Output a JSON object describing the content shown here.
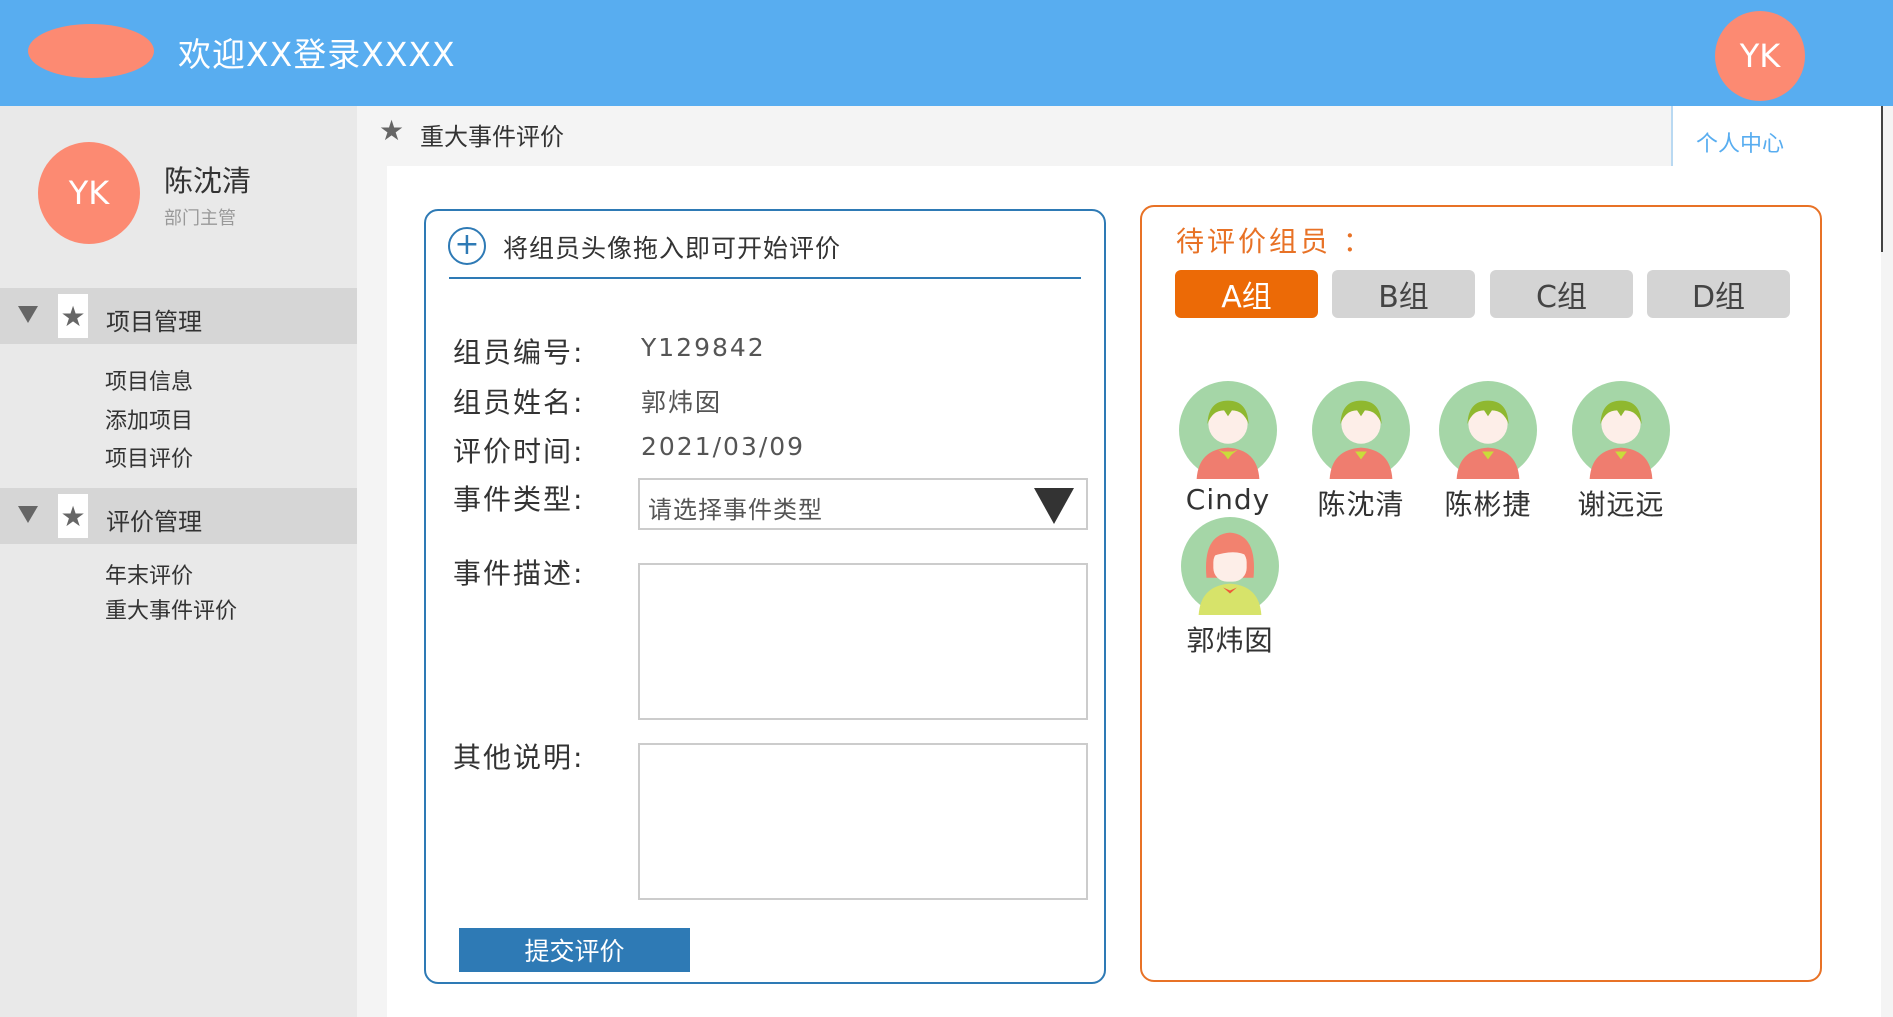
{
  "header": {
    "title": "欢迎XX登录XXXX",
    "avatar_text": "YK"
  },
  "user": {
    "avatar_text": "YK",
    "name": "陈沈清",
    "role": "部门主管"
  },
  "sidebar": {
    "groups": [
      {
        "label": "项目管理",
        "items": [
          "项目信息",
          "添加项目",
          "项目评价"
        ]
      },
      {
        "label": "评价管理",
        "items": [
          "年末评价",
          "重大事件评价"
        ]
      }
    ]
  },
  "breadcrumb": {
    "label": "重大事件评价"
  },
  "personal_center": "个人中心",
  "form": {
    "hint": "将组员头像拖入即可开始评价",
    "fields": [
      {
        "label": "组员编号:",
        "value": "Y129842"
      },
      {
        "label": "组员姓名:",
        "value": "郭炜囡"
      },
      {
        "label": "评价时间:",
        "value": "2021/03/09"
      }
    ],
    "event_type": {
      "label": "事件类型:",
      "placeholder": "请选择事件类型"
    },
    "event_desc": {
      "label": "事件描述:"
    },
    "other_notes": {
      "label": "其他说明:"
    },
    "submit": "提交评价"
  },
  "members_panel": {
    "title": "待评价组员 ：",
    "tabs": [
      "A组",
      "B组",
      "C组",
      "D组"
    ],
    "active_tab": "A组",
    "members": [
      {
        "name": "Cindy",
        "gender": "male"
      },
      {
        "name": "陈沈清",
        "gender": "male"
      },
      {
        "name": "陈彬捷",
        "gender": "male"
      },
      {
        "name": "谢远远",
        "gender": "male"
      },
      {
        "name": "郭炜囡",
        "gender": "female"
      }
    ]
  },
  "colors": {
    "header": "#58adf0",
    "accent_blue": "#2e7ab5",
    "accent_orange": "#e87226",
    "active_tab": "#ec6a06",
    "avatar": "#fc8a72"
  }
}
